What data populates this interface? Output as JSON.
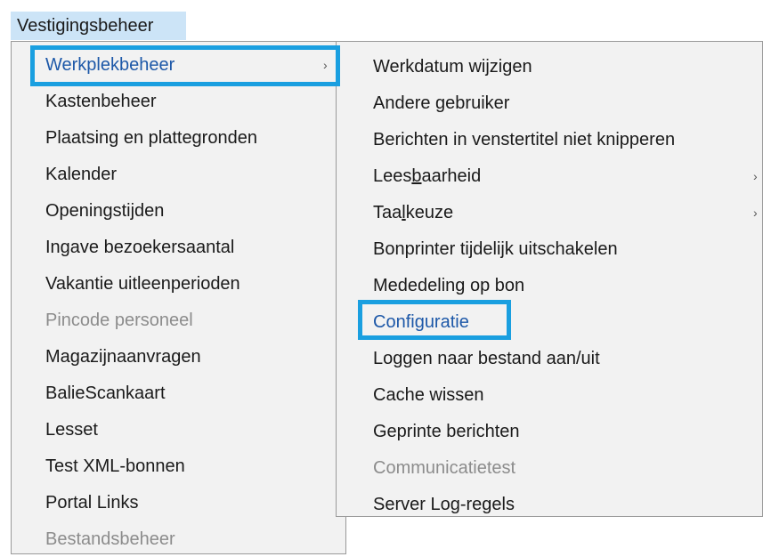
{
  "menubar": {
    "title": "Vestigingsbeheer"
  },
  "main_menu": {
    "items": [
      {
        "label": "Werkplekbeheer",
        "state": "highlighted",
        "has_submenu": true
      },
      {
        "label": "Kastenbeheer",
        "state": "normal"
      },
      {
        "label": "Plaatsing en plattegronden",
        "state": "normal"
      },
      {
        "label": "Kalender",
        "state": "normal"
      },
      {
        "label": "Openingstijden",
        "state": "normal"
      },
      {
        "label": "Ingave bezoekersaantal",
        "state": "normal"
      },
      {
        "label": "Vakantie uitleenperioden",
        "state": "normal"
      },
      {
        "label": "Pincode personeel",
        "state": "disabled"
      },
      {
        "label": "Magazijnaanvragen",
        "state": "normal"
      },
      {
        "label": "BalieScankaart",
        "state": "normal"
      },
      {
        "label": "Lesset",
        "state": "normal"
      },
      {
        "label": "Test XML-bonnen",
        "state": "normal"
      },
      {
        "label": "Portal Links",
        "state": "normal"
      },
      {
        "label": "Bestandsbeheer",
        "state": "disabled"
      }
    ]
  },
  "sub_menu": {
    "items": [
      {
        "label": "Werkdatum wijzigen",
        "state": "normal"
      },
      {
        "label": "Andere gebruiker",
        "state": "normal"
      },
      {
        "label": "Berichten in venstertitel niet knipperen",
        "state": "normal"
      },
      {
        "label_pre": "Lees",
        "label_u": "b",
        "label_post": "aarheid",
        "state": "normal",
        "has_submenu": true
      },
      {
        "label_pre": "Taa",
        "label_u": "l",
        "label_post": "keuze",
        "state": "normal",
        "has_submenu": true
      },
      {
        "label": "Bonprinter tijdelijk uitschakelen",
        "state": "normal"
      },
      {
        "label": "Mededeling op bon",
        "state": "normal"
      },
      {
        "label": "Configuratie",
        "state": "highlighted"
      },
      {
        "label": "Loggen naar bestand aan/uit",
        "state": "normal"
      },
      {
        "label": "Cache wissen",
        "state": "normal"
      },
      {
        "label": "Geprinte berichten",
        "state": "normal"
      },
      {
        "label": "Communicatietest",
        "state": "disabled"
      },
      {
        "label": "Server Log-regels",
        "state": "normal"
      }
    ]
  },
  "icons": {
    "submenu_arrow": "chevron-right-icon",
    "submenu_arrow_glyph": "›"
  },
  "colors": {
    "menubar_selected_bg": "#cce4f7",
    "menu_bg": "#f2f2f2",
    "highlight_text": "#1d58a8",
    "disabled_text": "#8c8c8c",
    "annotation_box": "#1a9fe0"
  }
}
